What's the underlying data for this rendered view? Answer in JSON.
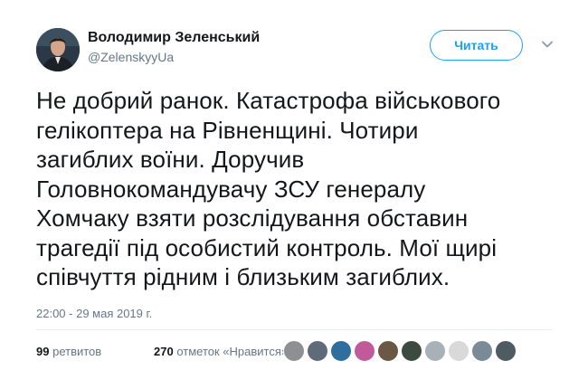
{
  "author": {
    "name": "Володимир Зеленський",
    "handle": "@ZelenskyyUa"
  },
  "follow_button": {
    "label": "Читать"
  },
  "menu": {
    "icon": "chevron-down-icon"
  },
  "tweet": {
    "lines": [
      "Не добрий ранок. Катастрофа військового",
      "гелікоптера на Рівненщині. Чотири",
      "загиблих воїни. Доручив",
      "Головнокомандувачу ЗСУ генералу",
      "Хомчаку взяти розслідування обставин",
      "трагедії під особистий контроль. Мої щирі",
      "співчуття рідним і близьким загиблих."
    ],
    "timestamp": "22:00 - 29 мая 2019 г."
  },
  "stats": {
    "retweets_count": "99",
    "retweets_label": "ретвитов",
    "likes_count": "270",
    "likes_label": "отметок «Нравится»"
  },
  "likers": [
    {
      "color": "#8d8f92"
    },
    {
      "color": "#5f6b78"
    },
    {
      "color": "#2f6f9f"
    },
    {
      "color": "#c05a9a"
    },
    {
      "color": "#6b5844"
    },
    {
      "color": "#3d4a3f"
    },
    {
      "color": "#a8b0b8"
    },
    {
      "color": "#d9d9d9"
    },
    {
      "color": "#7a8a96"
    },
    {
      "color": "#4e5b63"
    }
  ],
  "colors": {
    "accent": "#1da1f2",
    "muted": "#657786",
    "text": "#14171a"
  }
}
